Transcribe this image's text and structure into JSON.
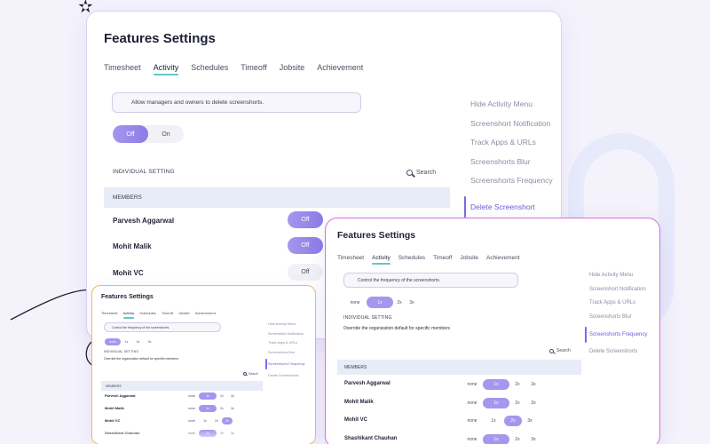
{
  "main": {
    "title": "Features Settings",
    "tabs": [
      "Timesheet",
      "Activity",
      "Schedules",
      "Timeoff",
      "Jobsite",
      "Achievement"
    ],
    "active_tab": "Activity",
    "note": "Allow managers and owners to delete screenshorts.",
    "toggle": {
      "off": "Off",
      "on": "On",
      "selected": "Off"
    },
    "individual_setting": "INDIVIDUAL SETTING",
    "search": "Search",
    "members_header": "MEMBERS",
    "members": [
      {
        "name": "Parvesh Aggarwal",
        "state": "Off"
      },
      {
        "name": "Mohit Malik",
        "state": "Off"
      },
      {
        "name": "Mohit VC",
        "state": "Off"
      }
    ],
    "sidebar": [
      "Hide Activity Menu",
      "Screenshort Notification",
      "Track Apps & URLs",
      "Screenshorts Blur",
      "Screenshorts Frequency",
      "Delete Screenshort"
    ],
    "sidebar_active": "Delete Screenshort"
  },
  "freq": {
    "title": "Features Settings",
    "tabs": [
      "Timesheet",
      "Activity",
      "Schedules",
      "Timeoff",
      "Jobsite",
      "Achievement"
    ],
    "active_tab": "Activity",
    "note": "Control the frequency of the screenshorts.",
    "options": [
      "none",
      "1x",
      "2x",
      "3x"
    ],
    "selected": "1x",
    "individual_setting": "INDIVIDUAL SETTING",
    "override_note": "Override the organization default for specific members",
    "search": "Search",
    "members_header": "MEMBERS",
    "members": [
      {
        "name": "Parvesh Aggarwal",
        "selected": "1x"
      },
      {
        "name": "Mohit Malik",
        "selected": "2x"
      },
      {
        "name": "Mohit VC",
        "selected": "2x"
      },
      {
        "name": "Shashikant Chauhan",
        "selected": "1x"
      }
    ],
    "sidebar": [
      "Hide Activity Menu",
      "Screenshort Notification",
      "Track Apps & URLs",
      "Screenshorts Blur",
      "Screenshorts Frequency",
      "Delete Screenshorts"
    ],
    "sidebar_active": "Screenshorts Frequency"
  },
  "mini": {
    "title": "Features Settings",
    "tabs": [
      "Timesheet",
      "Activity",
      "Schedules",
      "Timeoff",
      "Jobsite",
      "Achievement"
    ],
    "active_tab": "Activity",
    "note": "Control the frequency of the screenshorts.",
    "options": [
      "none",
      "1x",
      "2x",
      "3x"
    ],
    "selected": "none",
    "individual_setting": "INDIVIDUAL SETTING",
    "override_note": "Override the organization default for specific members",
    "search": "Search",
    "members_header": "MEMBERS",
    "members": [
      {
        "name": "Parvesh Aggarwal",
        "selected": "1x"
      },
      {
        "name": "Mohit Malik",
        "selected": "1x"
      },
      {
        "name": "Mohit VC",
        "selected": "3x"
      },
      {
        "name": "Shashikant Chauhan",
        "selected": "1x"
      }
    ],
    "sidebar": [
      "Hide Activity Menu",
      "Screenshort Notification",
      "Track Apps & URLs",
      "Screenshorts Blur",
      "Screenshorts Frequency",
      "Delete Screenshorts"
    ],
    "sidebar_active": "Screenshorts Frequency"
  }
}
